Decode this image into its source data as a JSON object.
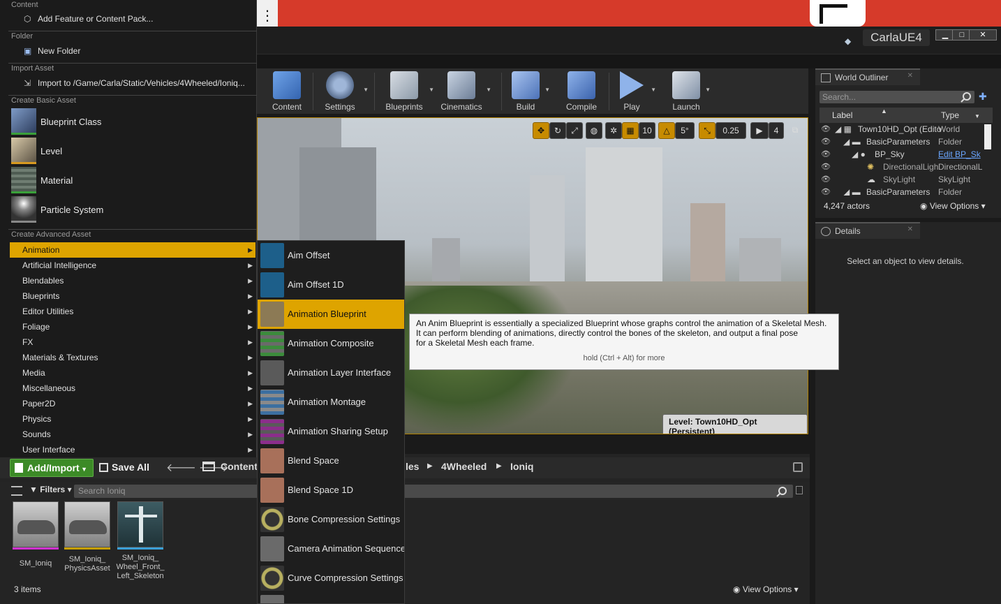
{
  "app": {
    "title": "CarlaUE4"
  },
  "toolbar": {
    "buttons": [
      {
        "label": "Content",
        "icon": "content-icon"
      },
      {
        "label": "Settings",
        "icon": "settings-icon"
      },
      {
        "label": "Blueprints",
        "icon": "blueprints-icon"
      },
      {
        "label": "Cinematics",
        "icon": "cinematics-icon"
      },
      {
        "label": "Build",
        "icon": "build-icon"
      },
      {
        "label": "Compile",
        "icon": "compile-icon"
      },
      {
        "label": "Play",
        "icon": "play-icon"
      },
      {
        "label": "Launch",
        "icon": "launch-icon"
      }
    ]
  },
  "viewport": {
    "grid_snap": "10",
    "rotation_snap": "5°",
    "scale_snap": "0.25",
    "camera_speed": "4",
    "level_label": "Level:  Town10HD_Opt (Persistent)"
  },
  "menu": {
    "sections": {
      "content": "Content",
      "folder": "Folder",
      "import": "Import Asset",
      "basic": "Create Basic Asset",
      "advanced": "Create Advanced Asset"
    },
    "add_feature": "Add Feature or Content Pack...",
    "new_folder": "New Folder",
    "import_to": "Import to /Game/Carla/Static/Vehicles/4Wheeled/Ioniq...",
    "basic_items": [
      {
        "label": "Blueprint Class",
        "icon": "blueprint-class-icon"
      },
      {
        "label": "Level",
        "icon": "level-icon"
      },
      {
        "label": "Material",
        "icon": "material-icon"
      },
      {
        "label": "Particle System",
        "icon": "particle-system-icon"
      }
    ],
    "advanced_items": [
      "Animation",
      "Artificial Intelligence",
      "Blendables",
      "Blueprints",
      "Editor Utilities",
      "Foliage",
      "FX",
      "Materials & Textures",
      "Media",
      "Miscellaneous",
      "Paper2D",
      "Physics",
      "Sounds",
      "User Interface"
    ],
    "selected_advanced": "Animation"
  },
  "submenu": {
    "items": [
      {
        "label": "Aim Offset",
        "icon": "aim-offset-icon"
      },
      {
        "label": "Aim Offset 1D",
        "icon": "aim-offset-1d-icon"
      },
      {
        "label": "Animation Blueprint",
        "icon": "animation-blueprint-icon"
      },
      {
        "label": "Animation Composite",
        "icon": "animation-composite-icon"
      },
      {
        "label": "Animation Layer Interface",
        "icon": "animation-layer-interface-icon"
      },
      {
        "label": "Animation Montage",
        "icon": "animation-montage-icon"
      },
      {
        "label": "Animation Sharing Setup",
        "icon": "animation-sharing-setup-icon"
      },
      {
        "label": "Blend Space",
        "icon": "blend-space-icon"
      },
      {
        "label": "Blend Space 1D",
        "icon": "blend-space-1d-icon"
      },
      {
        "label": "Bone Compression Settings",
        "icon": "bone-compression-settings-icon"
      },
      {
        "label": "Camera Animation Sequence",
        "icon": "camera-animation-sequence-icon"
      },
      {
        "label": "Curve Compression Settings",
        "icon": "curve-compression-settings-icon"
      }
    ],
    "selected": "Animation Blueprint"
  },
  "tooltip": {
    "line1": "An Anim Blueprint is essentially a specialized Blueprint whose graphs control the animation of a Skeletal Mesh.",
    "line2": "It can perform blending of animations, directly control the bones of the skeleton, and output a final pose",
    "line3": "for a Skeletal Mesh each frame.",
    "hint": "hold (Ctrl + Alt) for more"
  },
  "outliner": {
    "tab": "World Outliner",
    "search_placeholder": "Search...",
    "col_label": "Label",
    "col_type": "Type",
    "rows": [
      {
        "label": "Town10HD_Opt (Edito",
        "type": "World"
      },
      {
        "label": "BasicParameters",
        "type": "Folder"
      },
      {
        "label": "BP_Sky",
        "type": "Edit BP_Sk"
      },
      {
        "label": "DirectionalLigh",
        "type": "DirectionalL"
      },
      {
        "label": "SkyLight",
        "type": "SkyLight"
      },
      {
        "label": "BasicParameters",
        "type": "Folder"
      }
    ],
    "actor_count": "4,247 actors",
    "view_options": "View Options"
  },
  "details": {
    "tab": "Details",
    "empty": "Select an object to view details."
  },
  "content_browser": {
    "add_import": "Add/Import",
    "save_all": "Save All",
    "breadcrumbs": [
      "Content",
      "les",
      "4Wheeled",
      "Ioniq"
    ],
    "filters": "Filters",
    "search_placeholder": "Search Ioniq",
    "assets": [
      {
        "name": "SM_Ioniq",
        "bar_color": "#d030d0"
      },
      {
        "name": "SM_Ioniq_ PhysicsAsset",
        "bar_color": "#c8a000"
      },
      {
        "name": "SM_Ioniq_ Wheel_Front_ Left_Skeleton",
        "bar_color": "#3aa0d8"
      }
    ],
    "item_count": "3 items",
    "view_options": "View Options"
  }
}
